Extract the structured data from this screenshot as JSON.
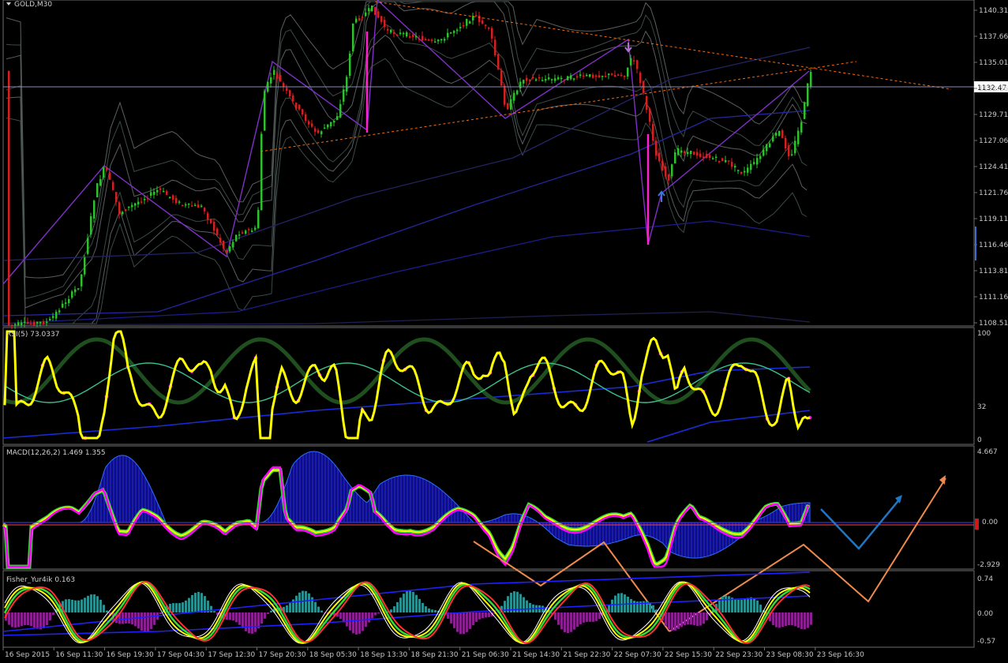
{
  "symbol_label": "GOLD,M30",
  "current_price": "1132.47",
  "price_axis": [
    "1140.31",
    "1137.66",
    "1135.01",
    "1132.36",
    "1129.71",
    "1127.06",
    "1124.41",
    "1121.76",
    "1119.11",
    "1116.46",
    "1113.81",
    "1111.16",
    "1108.51"
  ],
  "rsi": {
    "label": "RSI(5) 73.0337",
    "levels": [
      "100",
      "32",
      "0"
    ]
  },
  "macd": {
    "label": "MACD(12,26,2) 1.469 1.355",
    "levels": [
      "4.667",
      "0.00",
      "-2.929"
    ]
  },
  "fisher": {
    "label": "Fisher_Yur4ik 0.163",
    "levels": [
      "0.74",
      "0.00",
      "-0.57"
    ]
  },
  "time_axis": [
    "16 Sep 2015",
    "16 Sep 11:30",
    "16 Sep 19:30",
    "17 Sep 04:30",
    "17 Sep 12:30",
    "17 Sep 20:30",
    "18 Sep 05:30",
    "18 Sep 13:30",
    "18 Sep 21:30",
    "21 Sep 06:30",
    "21 Sep 14:30",
    "21 Sep 22:30",
    "22 Sep 07:30",
    "22 Sep 15:30",
    "22 Sep 23:30",
    "23 Sep 08:30",
    "23 Sep 16:30"
  ],
  "colors": {
    "background": "#000000",
    "grid_text": "#c8c8c8",
    "bull_candle": "#2fbf2f",
    "bear_candle": "#d42020",
    "rsi_line": "#ffff00",
    "rsi_dots": "#ff00ff",
    "macd_hist": "#1a1ae0",
    "macd_signal": "#ff00ff",
    "trend_dashed": "#ff6a00",
    "arrow_orange": "#f08a4b",
    "arrow_blue": "#1f77c4",
    "zero_line": "#5a5aff"
  }
}
